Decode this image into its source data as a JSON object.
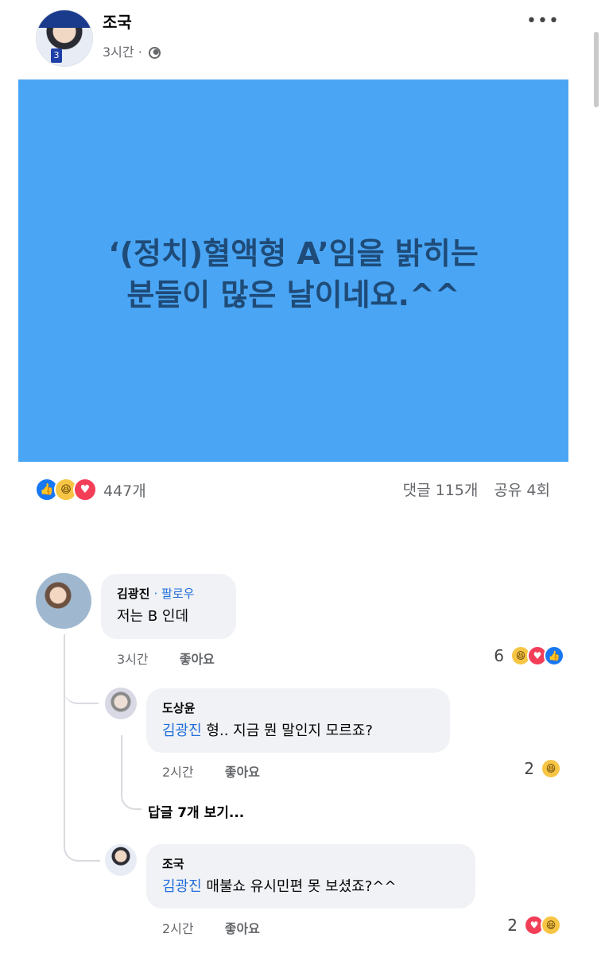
{
  "post": {
    "author": "조국",
    "time": "3시간 ·",
    "text": "‘(정치)혈액형 A’임을 밝히는\n분들이 많은 날이네요.^^",
    "background_color": "#4aa6f5",
    "more_icon": "more-dots-icon",
    "privacy_icon": "globe-icon"
  },
  "reactions": {
    "count": "447개",
    "types": [
      "like",
      "haha",
      "love"
    ],
    "comments": "댓글 115개",
    "shares": "공유 4회"
  },
  "comments": [
    {
      "author": "김광진",
      "follow": "· 팔로우",
      "text": "저는 B 인데",
      "time": "3시간",
      "like_label": "좋아요",
      "reaction_count": "6",
      "reaction_types": [
        "haha",
        "love",
        "like"
      ],
      "replies": [
        {
          "author": "도상윤",
          "tag": "김광진",
          "text": " 형.. 지금 뭔 말인지 모르죠?",
          "time": "2시간",
          "like_label": "좋아요",
          "reaction_count": "2",
          "reaction_types": [
            "haha"
          ]
        },
        {
          "author": "조국",
          "tag": "김광진",
          "text": " 매불쇼 유시민편 못 보셨죠?^^",
          "time": "2시간",
          "like_label": "좋아요",
          "reaction_count": "2",
          "reaction_types": [
            "love",
            "haha"
          ]
        }
      ],
      "view_replies": "답글 7개 보기..."
    }
  ]
}
